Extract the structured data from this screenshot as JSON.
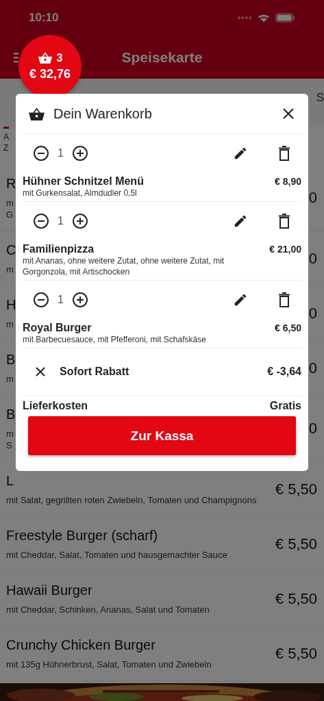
{
  "status_bar": {
    "time": "10:10"
  },
  "nav_bar": {
    "title": "Speisekarte"
  },
  "cart_badge": {
    "count": "3",
    "total": "€ 32,76"
  },
  "category_tabs": [
    {
      "label": "S",
      "selected": false
    }
  ],
  "category_info": {
    "lines": [
      "A",
      "Z"
    ]
  },
  "menu_items": [
    {
      "name": "R",
      "description": "m\nG",
      "price": "0"
    },
    {
      "name": "C",
      "description": "m",
      "price": "0"
    },
    {
      "name": "H",
      "description": "m",
      "price": "0"
    },
    {
      "name": "B",
      "description": "m",
      "price": "0"
    },
    {
      "name": "B",
      "description": "m\nS",
      "price": "0"
    },
    {
      "name": "L",
      "description": "mit Salat, gegrillten roten Zwiebeln, Tomaten und Champignons",
      "price": "€ 5,50"
    },
    {
      "name": "Freestyle Burger (scharf)",
      "description": "mit Cheddar, Salat, Tomaten und hausgemachter Sauce",
      "price": "€ 5,50"
    },
    {
      "name": "Hawaii Burger",
      "description": "mit Cheddar, Schinken, Ananas, Salat und Tomaten",
      "price": "€ 5,50"
    },
    {
      "name": "Crunchy Chicken Burger",
      "description": "mit 135g Hühnerbrust, Salat, Tomaten und Zwiebeln",
      "price": "€ 5,50"
    }
  ],
  "cart_dialog": {
    "title": "Dein Warenkorb",
    "items": [
      {
        "quantity": "1",
        "name": "Hühner Schnitzel Menü",
        "options": "mit Gurkensalat, Almdudler 0,5l",
        "price": "€ 8,90"
      },
      {
        "quantity": "1",
        "name": "Familienpizza",
        "options": "mit Ananas, ohne weitere Zutat, ohne weitere Zutat, mit Gorgonzola, mit Artischocken",
        "price": "€ 21,00"
      },
      {
        "quantity": "1",
        "name": "Royal Burger",
        "options": "mit Barbecuesauce, mit Pfefferoni, mit Schafskäse",
        "price": "€ 6,50"
      }
    ],
    "discount": {
      "label": "Sofort Rabatt",
      "amount": "€ -3,64"
    },
    "delivery": {
      "label": "Lieferkosten",
      "value": "Gratis"
    },
    "checkout_button": "Zur Kassa"
  }
}
